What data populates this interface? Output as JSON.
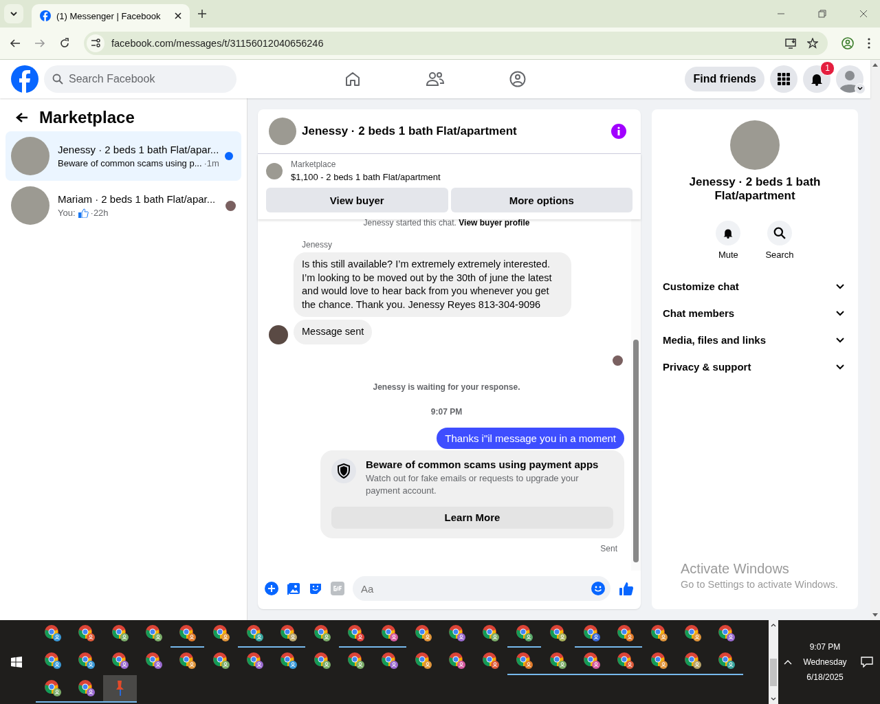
{
  "browser": {
    "tab_title": "(1) Messenger | Facebook",
    "url": "facebook.com/messages/t/31156012040656246"
  },
  "header": {
    "search_placeholder": "Search Facebook",
    "find_friends": "Find friends",
    "notification_count": "1"
  },
  "sidebar": {
    "title": "Marketplace",
    "threads": [
      {
        "name": "Jenessy · 2 beds 1 bath Flat/apar...",
        "preview": "Beware of common scams using p...",
        "time": "·1m",
        "selected": true,
        "unread": true,
        "kind": "text"
      },
      {
        "name": "Mariam · 2 beds 1 bath Flat/apar...",
        "preview": "You:",
        "time": "·22h",
        "selected": false,
        "unread": false,
        "kind": "like"
      }
    ]
  },
  "chat": {
    "title": "Jenessy · 2 beds 1 bath Flat/apartment",
    "listing_label": "Marketplace",
    "listing": "$1,100 - 2 beds 1 bath Flat/apartment",
    "buttons": [
      "View buyer",
      "More options"
    ],
    "started_text": "Jenessy started this chat.",
    "started_link": "View buyer profile",
    "messages": [
      {
        "kind": "sender",
        "text": "Jenessy"
      },
      {
        "kind": "incoming",
        "text": "Is this still available? I’m extremely extremely interested. I’m looking to be moved out by the 30th of june the latest and would love to hear back from you whenever you get the chance. Thank you. Jenessy Reyes 813-304-9096",
        "avatar": false
      },
      {
        "kind": "incoming",
        "text": "Message sent",
        "avatar": true
      },
      {
        "kind": "receipt"
      },
      {
        "kind": "notice",
        "text": "Jenessy is waiting for your response."
      },
      {
        "kind": "time",
        "text": "9:07 PM"
      },
      {
        "kind": "outgoing",
        "text": "Thanks i\"il message you in a moment"
      },
      {
        "kind": "warning",
        "title": "Beware of common scams using payment apps",
        "text": "Watch out for fake emails or requests to upgrade your payment account.",
        "button": "Learn More"
      },
      {
        "kind": "status",
        "text": "Sent"
      }
    ],
    "composer_placeholder": "Aa"
  },
  "details": {
    "title": "Jenessy · 2 beds 1 bath Flat/apartment",
    "actions": [
      "Mute",
      "Search"
    ],
    "sections": [
      {
        "label": "Customize chat",
        "expanded": false
      },
      {
        "label": "Chat members",
        "expanded": false
      },
      {
        "label": "Media, files and links",
        "expanded": false
      },
      {
        "label": "Privacy & support",
        "expanded": false
      }
    ]
  },
  "activation": {
    "title": "Activate Windows",
    "text": "Go to Settings to activate Windows."
  },
  "taskbar": {
    "apps": [
      {
        "color": "#3a9ad9",
        "running": false
      },
      {
        "color": "#e05a3a",
        "running": false
      },
      {
        "color": "#7cae6a",
        "running": false
      },
      {
        "color": "#7cae6a",
        "running": false
      },
      {
        "color": "#e07a2a",
        "running": true
      },
      {
        "color": "#e0953a",
        "running": false
      },
      {
        "color": "#3aa7a0",
        "running": true
      },
      {
        "color": "#b9a56a",
        "running": true
      },
      {
        "color": "#7cae6a",
        "running": false
      },
      {
        "color": "#e0403a",
        "running": true
      },
      {
        "color": "#d65aa0",
        "running": true
      },
      {
        "color": "#e0953a",
        "running": false
      },
      {
        "color": "#9a6ad0",
        "running": false
      },
      {
        "color": "#7cae6a",
        "running": false
      },
      {
        "color": "#5aa86a",
        "running": true
      },
      {
        "color": "#a8b05a",
        "running": false
      },
      {
        "color": "#3a6ad9",
        "running": true
      },
      {
        "color": "#e07a2a",
        "running": true
      },
      {
        "color": "#e0953a",
        "running": false
      },
      {
        "color": "#e0953a",
        "running": false
      },
      {
        "color": "#9a6ad0",
        "running": false
      },
      {
        "color": "#3a9ad9",
        "running": false
      },
      {
        "color": "#3a9ad9",
        "running": false
      },
      {
        "color": "#9a6ad0",
        "running": false
      },
      {
        "color": "#9a6ad0",
        "running": false
      },
      {
        "color": "#e0953a",
        "running": false
      },
      {
        "color": "#7cae6a",
        "running": false
      },
      {
        "color": "#9a6ad0",
        "running": false
      },
      {
        "color": "#3a9ad9",
        "running": false
      },
      {
        "color": "#7cae6a",
        "running": false
      },
      {
        "color": "#7cae6a",
        "running": false
      },
      {
        "color": "#9a6ad0",
        "running": false
      },
      {
        "color": "#e0953a",
        "running": false
      },
      {
        "color": "#d65aa0",
        "running": false
      },
      {
        "color": "#e05a3a",
        "running": false
      },
      {
        "color": "#e07a2a",
        "running": true
      },
      {
        "color": "#7cae6a",
        "running": true
      },
      {
        "color": "#d65aa0",
        "running": true
      },
      {
        "color": "#e05a3a",
        "running": true
      },
      {
        "color": "#e0953a",
        "running": true
      },
      {
        "color": "#b9a56a",
        "running": true
      },
      {
        "color": "#3aa7a0",
        "running": true
      },
      {
        "color": "#7cae6a",
        "running": true
      },
      {
        "color": "#9a6ad0",
        "running": true
      }
    ],
    "time": "9:07 PM",
    "day": "Wednesday",
    "date": "6/18/2025"
  }
}
